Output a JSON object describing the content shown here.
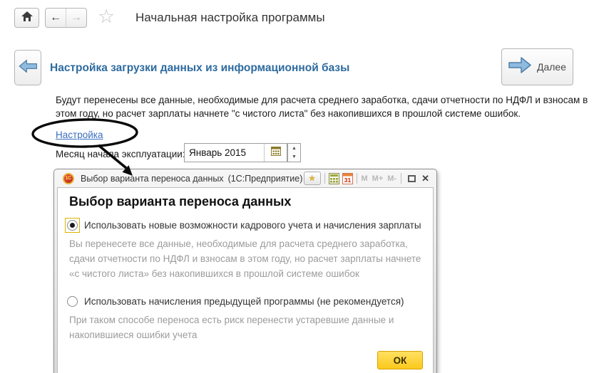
{
  "page": {
    "title": "Начальная настройка программы"
  },
  "toolbar": {
    "home_icon": "home-icon",
    "back_arrow": "←",
    "forward_arrow": "→",
    "favorite_star": "☆"
  },
  "wizard": {
    "title": "Настройка загрузки данных из информационной базы",
    "next_label": "Далее",
    "description": "Будут перенесены все данные, необходимые для расчета среднего заработка, сдачи отчетности по НДФЛ и взносам в этом году, но расчет зарплаты начнете \"с чистого листа\" без накопившихся в прошлой системе ошибок.",
    "settings_link": "Настройка",
    "month_label": "Месяц начала эксплуатации:",
    "month_value": "Январь 2015"
  },
  "dialog": {
    "title": "Выбор варианта переноса данных",
    "app_suffix": "(1С:Предприятие)",
    "logo_text": "1С",
    "heading": "Выбор варианта переноса данных",
    "options": [
      {
        "label": "Использовать новые возможности кадрового учета и начисления зарплаты",
        "selected": true,
        "description": "Вы перенесете все данные, необходимые для расчета среднего заработка, сдачи отчетности по НДФЛ и взносам в этом году, но расчет зарплаты начнете «с чистого листа» без накопившихся в прошлой системе ошибок"
      },
      {
        "label": "Использовать начисления предыдущей программы (не рекомендуется)",
        "selected": false,
        "description": "При таком способе переноса есть риск перенести устаревшие данные и накопившиеся ошибки учета"
      }
    ],
    "titlebar_buttons": [
      "M",
      "M+",
      "M-"
    ],
    "calendar_icon_text": "31",
    "close_label": "✕",
    "ok_label": "ОК"
  },
  "colors": {
    "accent_blue": "#2e6b9f",
    "link_blue": "#3a6dbf",
    "arrow_fill": "#8fbbde",
    "arrow_stroke": "#4f7ea8",
    "ok_yellow": "#fbc91c",
    "focus_yellow": "#dcb400"
  }
}
